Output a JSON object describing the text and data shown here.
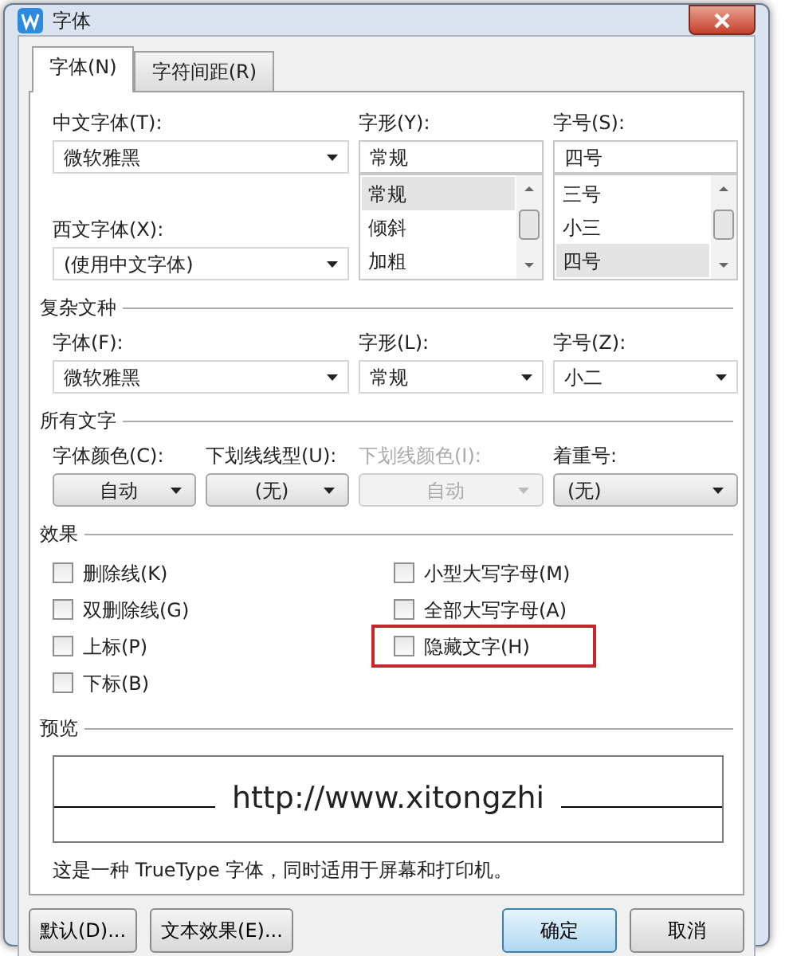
{
  "window": {
    "title": "字体"
  },
  "tabs": [
    {
      "label": "字体(N)",
      "selected": true
    },
    {
      "label": "字符间距(R)",
      "selected": false
    }
  ],
  "chinese_font": {
    "label": "中文字体(T):",
    "value": "微软雅黑"
  },
  "western_font": {
    "label": "西文字体(X):",
    "value": "(使用中文字体)"
  },
  "style": {
    "label": "字形(Y):",
    "value": "常规",
    "options": [
      {
        "label": "常规",
        "selected": true
      },
      {
        "label": "倾斜",
        "selected": false
      },
      {
        "label": "加粗",
        "selected": false
      }
    ]
  },
  "size": {
    "label": "字号(S):",
    "value": "四号",
    "options": [
      {
        "label": "三号",
        "selected": false
      },
      {
        "label": "小三",
        "selected": false
      },
      {
        "label": "四号",
        "selected": true
      }
    ]
  },
  "complex_script": {
    "heading": "复杂文种",
    "fields": [
      {
        "label": "字体(F):",
        "value": "微软雅黑"
      },
      {
        "label": "字形(L):",
        "value": "常规"
      },
      {
        "label": "字号(Z):",
        "value": "小二"
      }
    ]
  },
  "all_text": {
    "heading": "所有文字",
    "fields": [
      {
        "label": "字体颜色(C):",
        "value": "自动",
        "kind": "button",
        "disabled": false
      },
      {
        "label": "下划线线型(U):",
        "value": "(无)",
        "kind": "button",
        "disabled": false
      },
      {
        "label": "下划线颜色(I):",
        "value": "自动",
        "kind": "button",
        "disabled": true
      },
      {
        "label": "着重号:",
        "value": "(无)",
        "kind": "combo",
        "disabled": false
      }
    ]
  },
  "effects": {
    "heading": "效果",
    "left": [
      {
        "label": "删除线(K)",
        "checked": false,
        "highlighted": false
      },
      {
        "label": "双删除线(G)",
        "checked": false,
        "highlighted": false
      },
      {
        "label": "上标(P)",
        "checked": false,
        "highlighted": false
      },
      {
        "label": "下标(B)",
        "checked": false,
        "highlighted": false
      }
    ],
    "right": [
      {
        "label": "小型大写字母(M)",
        "checked": false,
        "highlighted": false
      },
      {
        "label": "全部大写字母(A)",
        "checked": false,
        "highlighted": false
      },
      {
        "label": "隐藏文字(H)",
        "checked": false,
        "highlighted": true
      }
    ]
  },
  "preview": {
    "heading": "预览",
    "sample": "http://www.xitongzhi",
    "note": "这是一种 TrueType 字体，同时适用于屏幕和打印机。"
  },
  "buttons": [
    {
      "label": "默认(D)...",
      "default": false
    },
    {
      "label": "文本效果(E)...",
      "default": false
    },
    {
      "label": "确定",
      "default": true
    },
    {
      "label": "取消",
      "default": false
    }
  ]
}
